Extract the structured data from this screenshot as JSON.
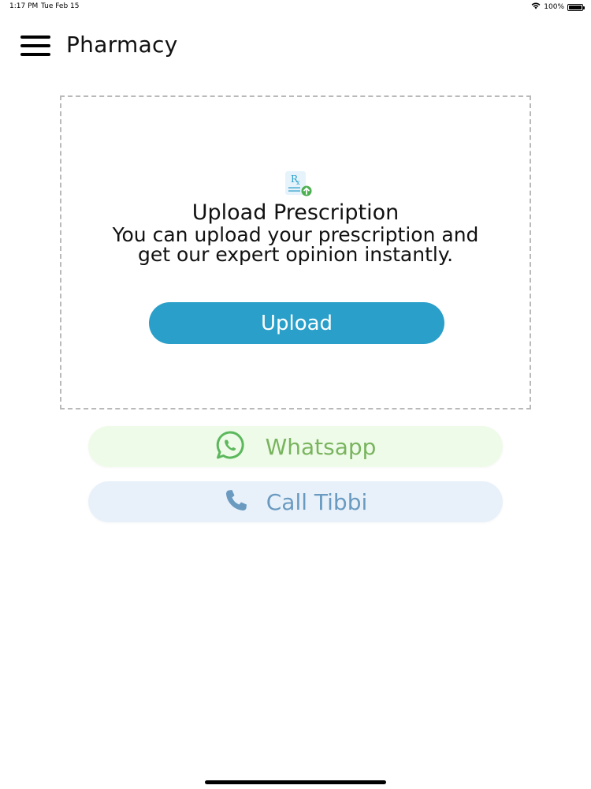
{
  "status_bar": {
    "time": "1:17 PM",
    "date": "Tue Feb 15",
    "battery": "100%",
    "wifi_icon": "wifi-icon",
    "battery_icon": "battery-icon"
  },
  "header": {
    "title": "Pharmacy",
    "menu_icon": "hamburger-menu-icon"
  },
  "upload_card": {
    "icon": "prescription-upload-icon",
    "heading": "Upload Prescription",
    "description": "You can upload your prescription and get our expert opinion instantly.",
    "button_label": "Upload"
  },
  "contact": {
    "whatsapp_label": "Whatsapp",
    "whatsapp_icon": "whatsapp-icon",
    "call_label": "Call Tibbi",
    "call_icon": "phone-icon"
  },
  "colors": {
    "upload_button": "#2a9fc9",
    "whatsapp_bg": "#effbe9",
    "whatsapp_text": "#79b45e",
    "call_bg": "#e8f1fa",
    "call_text": "#6a9ac0"
  }
}
